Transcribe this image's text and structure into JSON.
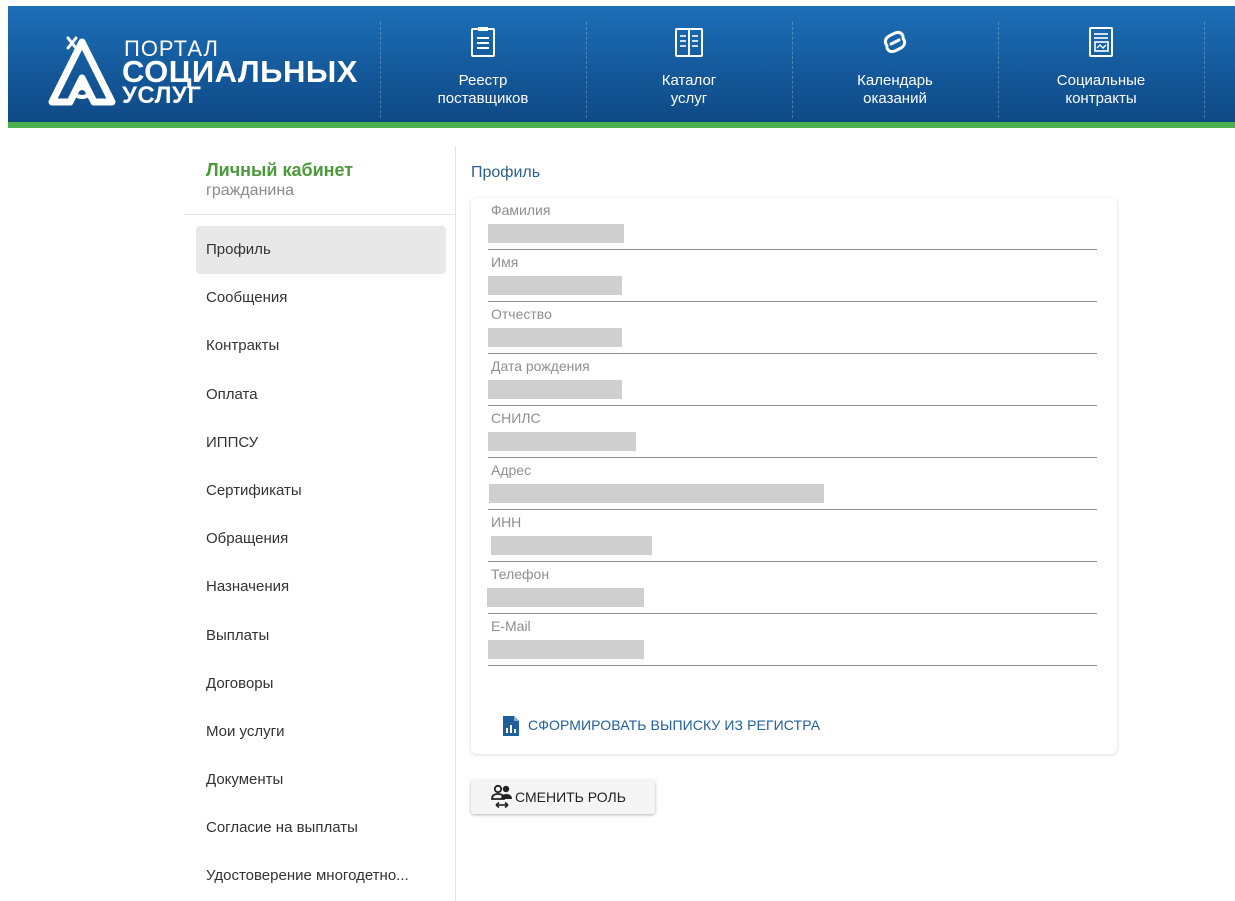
{
  "colors": {
    "header_blue": "#14599b",
    "accent_green": "#4caf50",
    "link_blue": "#1e5f9c",
    "title_green": "#4a9a3a"
  },
  "logo": {
    "line1": "ПОРТАЛ",
    "line2": "СОЦИАЛЬНЫХ",
    "line3": "УСЛУГ"
  },
  "nav": [
    {
      "icon": "clipboard-list-icon",
      "line1": "Реестр",
      "line2": "поставщиков"
    },
    {
      "icon": "open-book-icon",
      "line1": "Каталог",
      "line2": "услуг"
    },
    {
      "icon": "chain-link-icon",
      "line1": "Календарь",
      "line2": "оказаний"
    },
    {
      "icon": "contract-document-icon",
      "line1": "Социальные",
      "line2": "контракты"
    }
  ],
  "sidebar": {
    "title": "Личный кабинет",
    "subtitle": "гражданина",
    "active_index": 0,
    "items": [
      "Профиль",
      "Сообщения",
      "Контракты",
      "Оплата",
      "ИППСУ",
      "Сертификаты",
      "Обращения",
      "Назначения",
      "Выплаты",
      "Договоры",
      "Мои услуги",
      "Документы",
      "Согласие на выплаты",
      "Удостоверение многодетно..."
    ]
  },
  "profile": {
    "title": "Профиль",
    "fields": [
      {
        "label": "Фамилия"
      },
      {
        "label": "Имя"
      },
      {
        "label": "Отчество"
      },
      {
        "label": "Дата рождения"
      },
      {
        "label": "СНИЛС"
      },
      {
        "label": "Адрес"
      },
      {
        "label": "ИНН"
      },
      {
        "label": "Телефон"
      },
      {
        "label": "E-Mail"
      }
    ],
    "report_link": "СФОРМИРОВАТЬ ВЫПИСКУ ИЗ РЕГИСТРА",
    "report_icon": "report-chart-icon"
  },
  "change_role_button": {
    "label": "СМЕНИТЬ РОЛЬ",
    "icon": "swap-users-icon"
  }
}
